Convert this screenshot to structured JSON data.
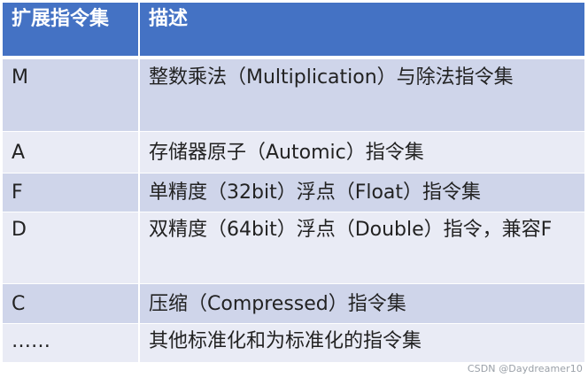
{
  "table": {
    "headers": {
      "extension": "扩展指令集",
      "description": "描述"
    },
    "rows": [
      {
        "code": "M",
        "description": "整数乘法（Multiplication）与除法指令集"
      },
      {
        "code": "A",
        "description": "存储器原子（Automic）指令集"
      },
      {
        "code": "F",
        "description": "单精度（32bit）浮点（Float）指令集"
      },
      {
        "code": "D",
        "description": "双精度（64bit）浮点（Double）指令，兼容F"
      },
      {
        "code": "C",
        "description": "压缩（Compressed）指令集"
      },
      {
        "code": "……",
        "description": "其他标准化和为标准化的指令集"
      }
    ]
  },
  "watermark": "CSDN @Daydreamer10",
  "colors": {
    "header_bg": "#4472c4",
    "row_dark": "#cfd5ea",
    "row_light": "#e9ebf5"
  }
}
